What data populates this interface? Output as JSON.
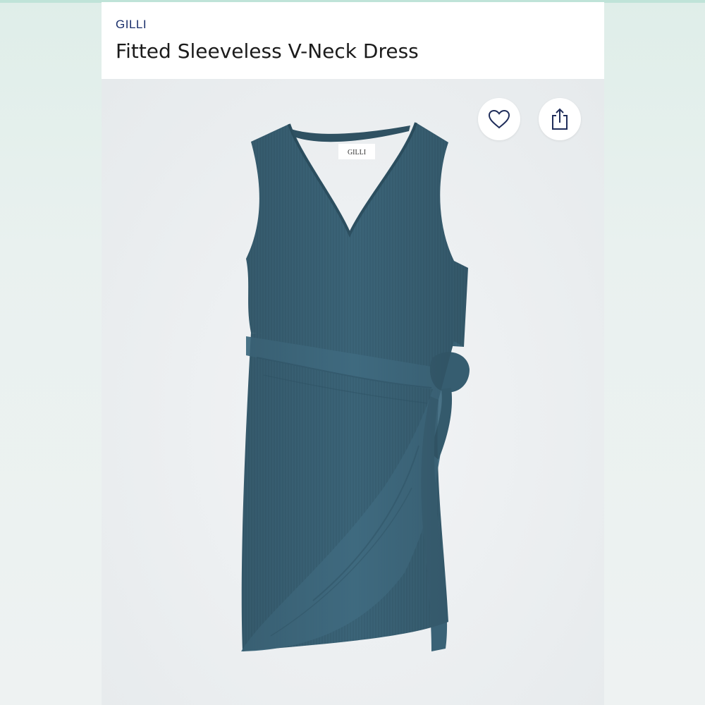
{
  "header": {
    "brand": "GILLI",
    "title": "Fitted Sleeveless V-Neck Dress"
  },
  "product_image": {
    "label_text": "GILLI"
  },
  "actions": {
    "favorite_icon": "heart-icon",
    "share_icon": "share-icon"
  },
  "colors": {
    "accent": "#bfe3d8",
    "brand_text": "#1a2f6b",
    "dress": "#3b6478"
  }
}
